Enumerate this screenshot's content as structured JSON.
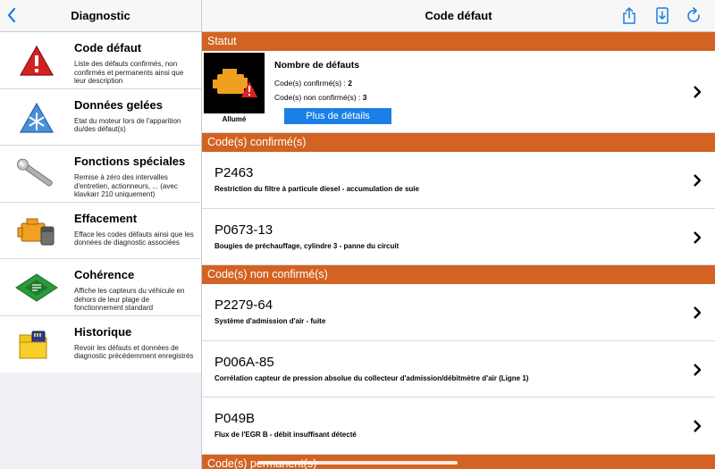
{
  "sidebar": {
    "title": "Diagnostic",
    "items": [
      {
        "title": "Code défaut",
        "desc": "Liste des défauts confirmés, non confirmés et permanents ainsi que leur description",
        "icon": "warning-icon"
      },
      {
        "title": "Données gelées",
        "desc": "Etat du moteur lors de l'apparition du/des défaut(s)",
        "icon": "snowflake-icon"
      },
      {
        "title": "Fonctions spéciales",
        "desc": "Remise à zéro des intervalles d'entretien, actionneurs, ... (avec klavkarr 210 uniquement)",
        "icon": "wrench-icon"
      },
      {
        "title": "Effacement",
        "desc": "Efface les codes défauts ainsi que les données de diagnostic associées",
        "icon": "engine-eraser-icon"
      },
      {
        "title": "Cohérence",
        "desc": "Affiche les capteurs du véhicule en dehors de leur plage de fonctionnement standard",
        "icon": "circuit-board-icon"
      },
      {
        "title": "Historique",
        "desc": "Revoir les défauts et données de diagnostic précédemment enregistrés",
        "icon": "folder-sdcard-icon"
      }
    ]
  },
  "main": {
    "title": "Code défaut",
    "statut": {
      "section": "Statut",
      "engine_label": "Allumé",
      "title": "Nombre de défauts",
      "confirmed_label": "Code(s) confirmé(s) : ",
      "confirmed_count": "2",
      "unconfirmed_label": "Code(s) non confirmé(s) : ",
      "unconfirmed_count": "3",
      "details_button": "Plus de détails"
    },
    "confirmed": {
      "section": "Code(s) confirmé(s)",
      "codes": [
        {
          "code": "P2463",
          "desc": "Restriction du filtre à particule diesel - accumulation de suie"
        },
        {
          "code": "P0673-13",
          "desc": "Bougies de préchauffage, cylindre 3 - panne du circuit"
        }
      ]
    },
    "unconfirmed": {
      "section": "Code(s) non confirmé(s)",
      "codes": [
        {
          "code": "P2279-64",
          "desc": "Système d'admission d'air - fuite"
        },
        {
          "code": "P006A-85",
          "desc": "Corrélation capteur de pression absolue du collecteur d'admission/débitmètre d'air (Ligne 1)"
        },
        {
          "code": "P049B",
          "desc": "Flux de l'EGR B - débit insuffisant détecté"
        }
      ]
    },
    "permanent": {
      "section": "Code(s) permanent(s)"
    }
  },
  "colors": {
    "accent": "#d36322",
    "link": "#1a7fe6",
    "engine_warning": "#f0a020"
  }
}
